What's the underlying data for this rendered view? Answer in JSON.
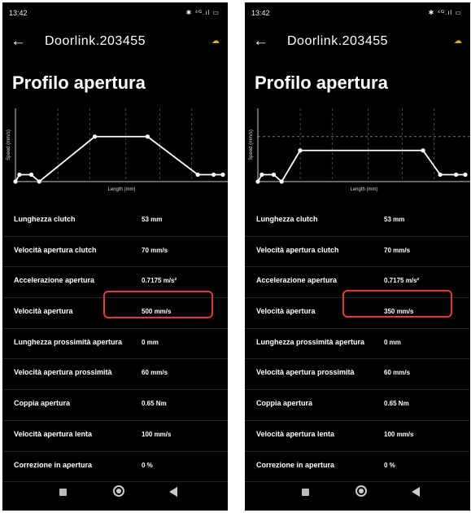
{
  "colors": {
    "background": "#000000",
    "text": "#ffffff",
    "highlight": "#e53935",
    "cloud": "#e0b400"
  },
  "screens": [
    {
      "status": {
        "time": "13:42",
        "icons": "✱ ⁴ᴳ.ıl ▭"
      },
      "header": {
        "back_icon": "arrow-left-icon",
        "title": "Doorlink.203455",
        "cloud_icon": "cloud-icon"
      },
      "heading": "Profilo apertura",
      "chart_data": {
        "type": "line",
        "title": "",
        "xlabel": "Length (mm)",
        "ylabel": "Speed (mm/s)",
        "series": [
          {
            "x": [
              0,
              3,
              12,
              18,
              60,
              100,
              138,
              150,
              157
            ],
            "y": [
              0,
              10,
              10,
              0,
              65,
              65,
              10,
              10,
              10
            ]
          }
        ],
        "xlim": [
          0,
          157
        ],
        "ylim": [
          0,
          100
        ],
        "dashed_hline": null
      },
      "rows": [
        {
          "label": "Lunghezza clutch",
          "value": "53 mm"
        },
        {
          "label": "Velocità apertura clutch",
          "value": "70 mm/s"
        },
        {
          "label": "Accelerazione apertura",
          "value": "0.7175 m/s²"
        },
        {
          "label": "Velocità apertura",
          "value": "500 mm/s"
        },
        {
          "label": "Lunghezza prossimità apertura",
          "value": "0 mm"
        },
        {
          "label": "Velocità apertura prossimità",
          "value": "60 mm/s"
        },
        {
          "label": "Coppia apertura",
          "value": "0.65 Nm"
        },
        {
          "label": "Velocità apertura lenta",
          "value": "100 mm/s"
        },
        {
          "label": "Correzione in apertura",
          "value": "0 %"
        }
      ]
    },
    {
      "status": {
        "time": "13:42",
        "icons": "✱ ⁴ᴳ.ıl ▭"
      },
      "header": {
        "back_icon": "arrow-left-icon",
        "title": "Doorlink.203455",
        "cloud_icon": "cloud-icon"
      },
      "heading": "Profilo apertura",
      "chart_data": {
        "type": "line",
        "title": "",
        "xlabel": "Length (mm)",
        "ylabel": "Speed (mm/s)",
        "series": [
          {
            "x": [
              0,
              3,
              12,
              18,
              32,
              125,
              138,
              150,
              157
            ],
            "y": [
              0,
              10,
              10,
              0,
              45,
              45,
              10,
              10,
              10
            ]
          }
        ],
        "xlim": [
          0,
          157
        ],
        "ylim": [
          0,
          100
        ],
        "dashed_hline": 65
      },
      "rows": [
        {
          "label": "Lunghezza clutch",
          "value": "53 mm"
        },
        {
          "label": "Velocità apertura clutch",
          "value": "70 mm/s"
        },
        {
          "label": "Accelerazione apertura",
          "value": "0.7175 m/s²"
        },
        {
          "label": "Velocità apertura",
          "value": "350 mm/s"
        },
        {
          "label": "Lunghezza prossimità apertura",
          "value": "0 mm"
        },
        {
          "label": "Velocità apertura prossimità",
          "value": "60 mm/s"
        },
        {
          "label": "Coppia apertura",
          "value": "0.65 Nm"
        },
        {
          "label": "Velocità apertura lenta",
          "value": "100 mm/s"
        },
        {
          "label": "Correzione in apertura",
          "value": "0 %"
        }
      ]
    }
  ]
}
